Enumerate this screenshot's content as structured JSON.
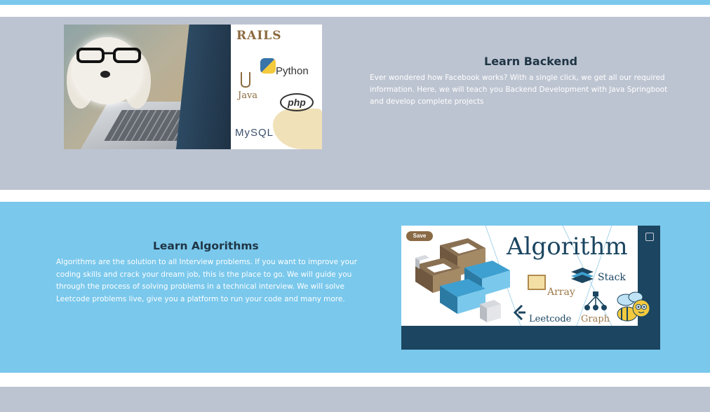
{
  "backend": {
    "title": "Learn Backend",
    "description": "Ever wondered how Facebook works? With a single click, we get all our required information. Here, we will teach you Backend Development with Java Springboot and develop complete projects",
    "image_logos": {
      "rails": "RAILS",
      "python": "Python",
      "java": "Java",
      "php": "php",
      "mysql": "MySQL"
    }
  },
  "algorithms": {
    "title": "Learn Algorithms",
    "description": "Algorithms are the solution to all Interview problems. If you want to improve your coding skills and crack your dream job, this is the place to go. We will guide you through the process of solving problems in a technical interview. We will solve Leetcode problems live, give you a platform to run your code and many more.",
    "image": {
      "heading": "Algorithm",
      "save_label": "Save",
      "labels": {
        "stack": "Stack",
        "array": "Array",
        "leetcode": "Leetcode",
        "graph": "Graph"
      }
    }
  },
  "colors": {
    "accent_blue": "#7ac8ec",
    "section_grey": "#bdc4d1",
    "title_dark": "#1f3545",
    "navy": "#1b4560"
  }
}
